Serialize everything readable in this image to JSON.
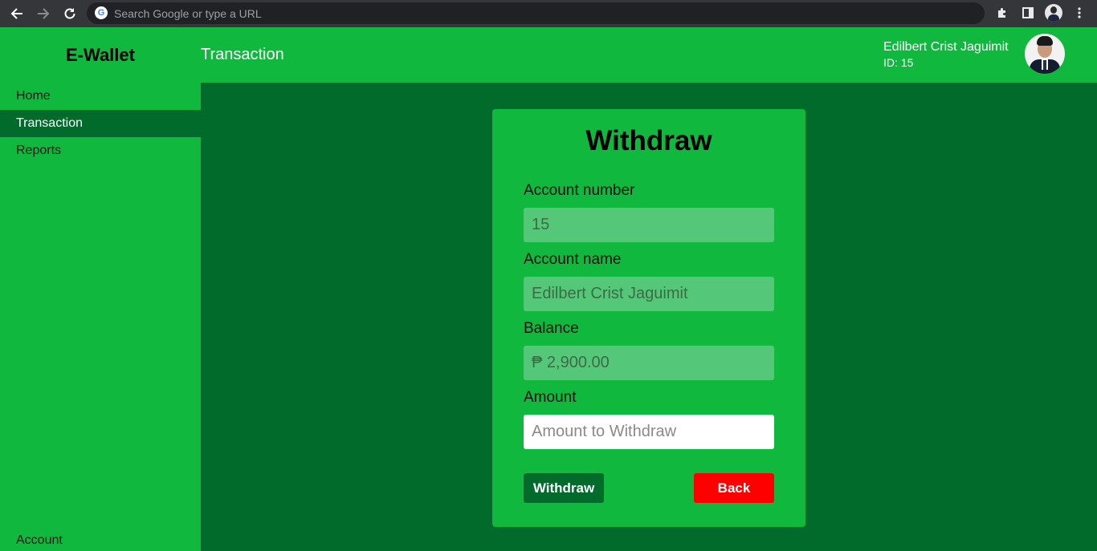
{
  "browser": {
    "omnibox_placeholder": "Search Google or type a URL",
    "icons": [
      "back-arrow-icon",
      "forward-arrow-icon",
      "reload-icon",
      "google-icon",
      "extensions-icon",
      "side-panel-icon",
      "profile-avatar-icon",
      "kebab-menu-icon"
    ]
  },
  "header": {
    "brand": "E-Wallet",
    "page_title": "Transaction",
    "user_name": "Edilbert Crist Jaguimit",
    "user_id": "ID: 15"
  },
  "sidebar": {
    "items": [
      {
        "label": "Home",
        "active": false
      },
      {
        "label": "Transaction",
        "active": true
      },
      {
        "label": "Reports",
        "active": false
      }
    ],
    "account_label": "Account"
  },
  "withdraw_form": {
    "title": "Withdraw",
    "account_number_label": "Account number",
    "account_number_value": "15",
    "account_name_label": "Account name",
    "account_name_value": "Edilbert Crist Jaguimit",
    "balance_label": "Balance",
    "balance_value": "₱ 2,900.00",
    "amount_label": "Amount",
    "amount_placeholder": "Amount to Withdraw",
    "withdraw_button": "Withdraw",
    "back_button": "Back"
  },
  "colors": {
    "primary_green": "#10b83e",
    "dark_green": "#006b2b",
    "readonly_field": "#55c779",
    "danger": "#ff0000"
  }
}
